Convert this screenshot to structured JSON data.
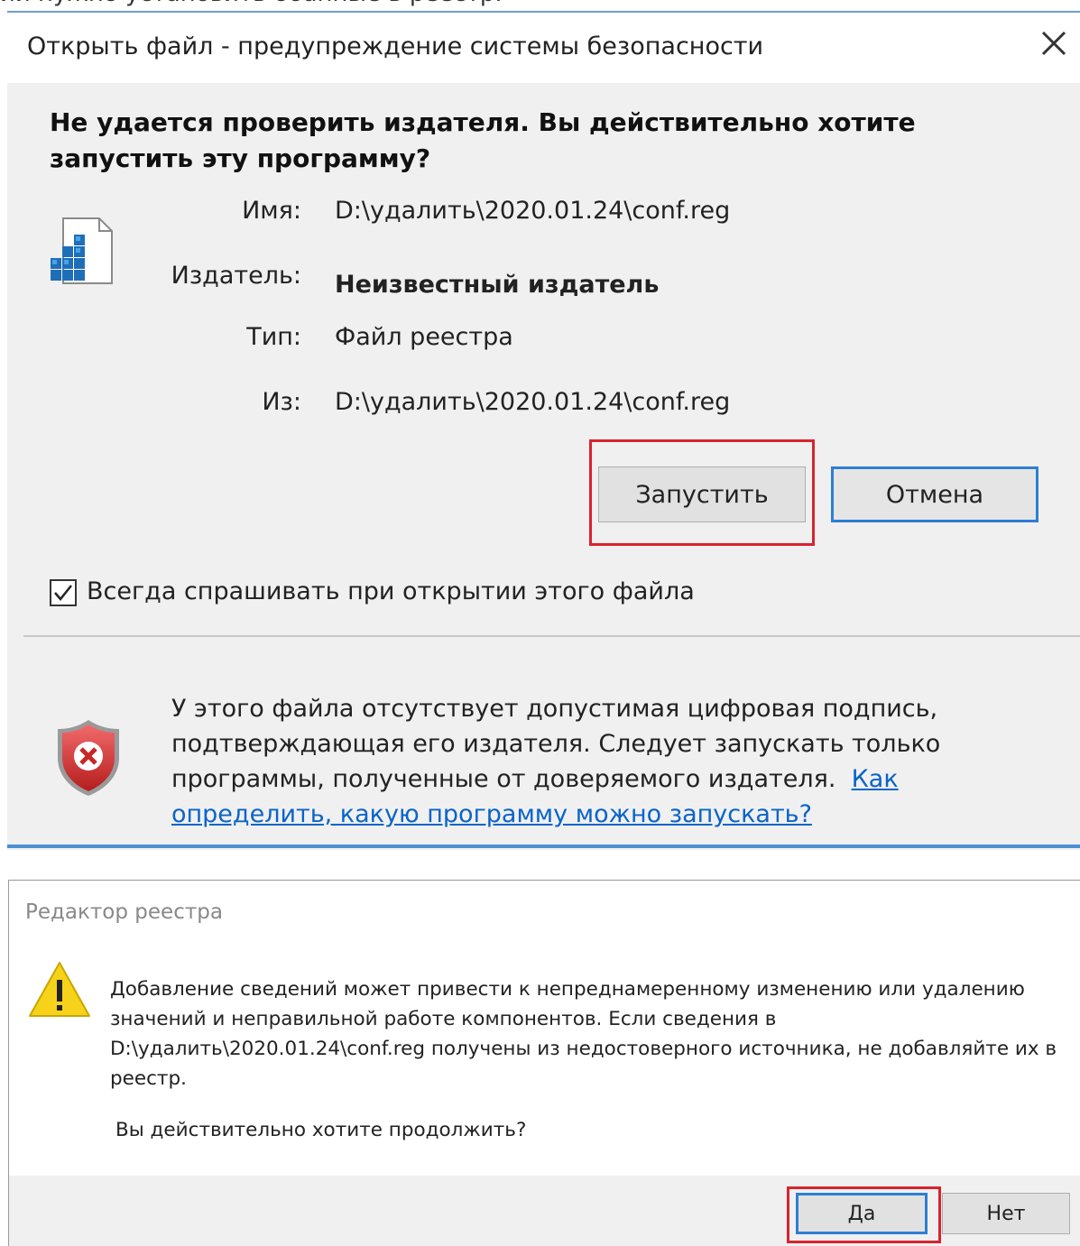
{
  "caption_cutoff": "ии нужно установить обанные в реестр.",
  "security_dialog": {
    "title": "Открыть файл - предупреждение системы безопасности",
    "question": "Не удается проверить издателя.  Вы действительно хотите запустить эту программу?",
    "fields": [
      {
        "label": "Имя:",
        "value": "D:\\удалить\\2020.01.24\\conf.reg"
      },
      {
        "label": "Издатель:",
        "value": "Неизвестный издатель"
      },
      {
        "label": "Тип:",
        "value": "Файл реестра"
      },
      {
        "label": "Из:",
        "value": "D:\\удалить\\2020.01.24\\conf.reg"
      }
    ],
    "run_button": "Запустить",
    "cancel_button": "Отмена",
    "always_ask_label": "Всегда спрашивать при открытии этого файла",
    "always_ask_checked": true,
    "warning_text": "У этого файла отсутствует допустимая цифровая подпись, подтверждающая его издателя.  Следует запускать только программы, полученные от доверяемого издателя.",
    "warning_link": "Как определить, какую программу можно запускать?",
    "icons": {
      "close": "close-icon",
      "file": "registry-file-icon",
      "shield": "security-shield-icon"
    },
    "colors": {
      "accent": "#2d7fd3",
      "highlight_frame": "#d9232d",
      "link": "#0a64c8"
    }
  },
  "regedit_dialog": {
    "title": "Редактор реестра",
    "message": "Добавление сведений может привести к непреднамеренному изменению или удалению значений и неправильной работе компонентов. Если сведения в D:\\удалить\\2020.01.24\\conf.reg получены из недостоверного источника, не добавляйте их в реестр.",
    "question": "Вы действительно хотите продолжить?",
    "yes_button": "Да",
    "no_button": "Нет",
    "icons": {
      "warning": "warning-icon"
    }
  }
}
